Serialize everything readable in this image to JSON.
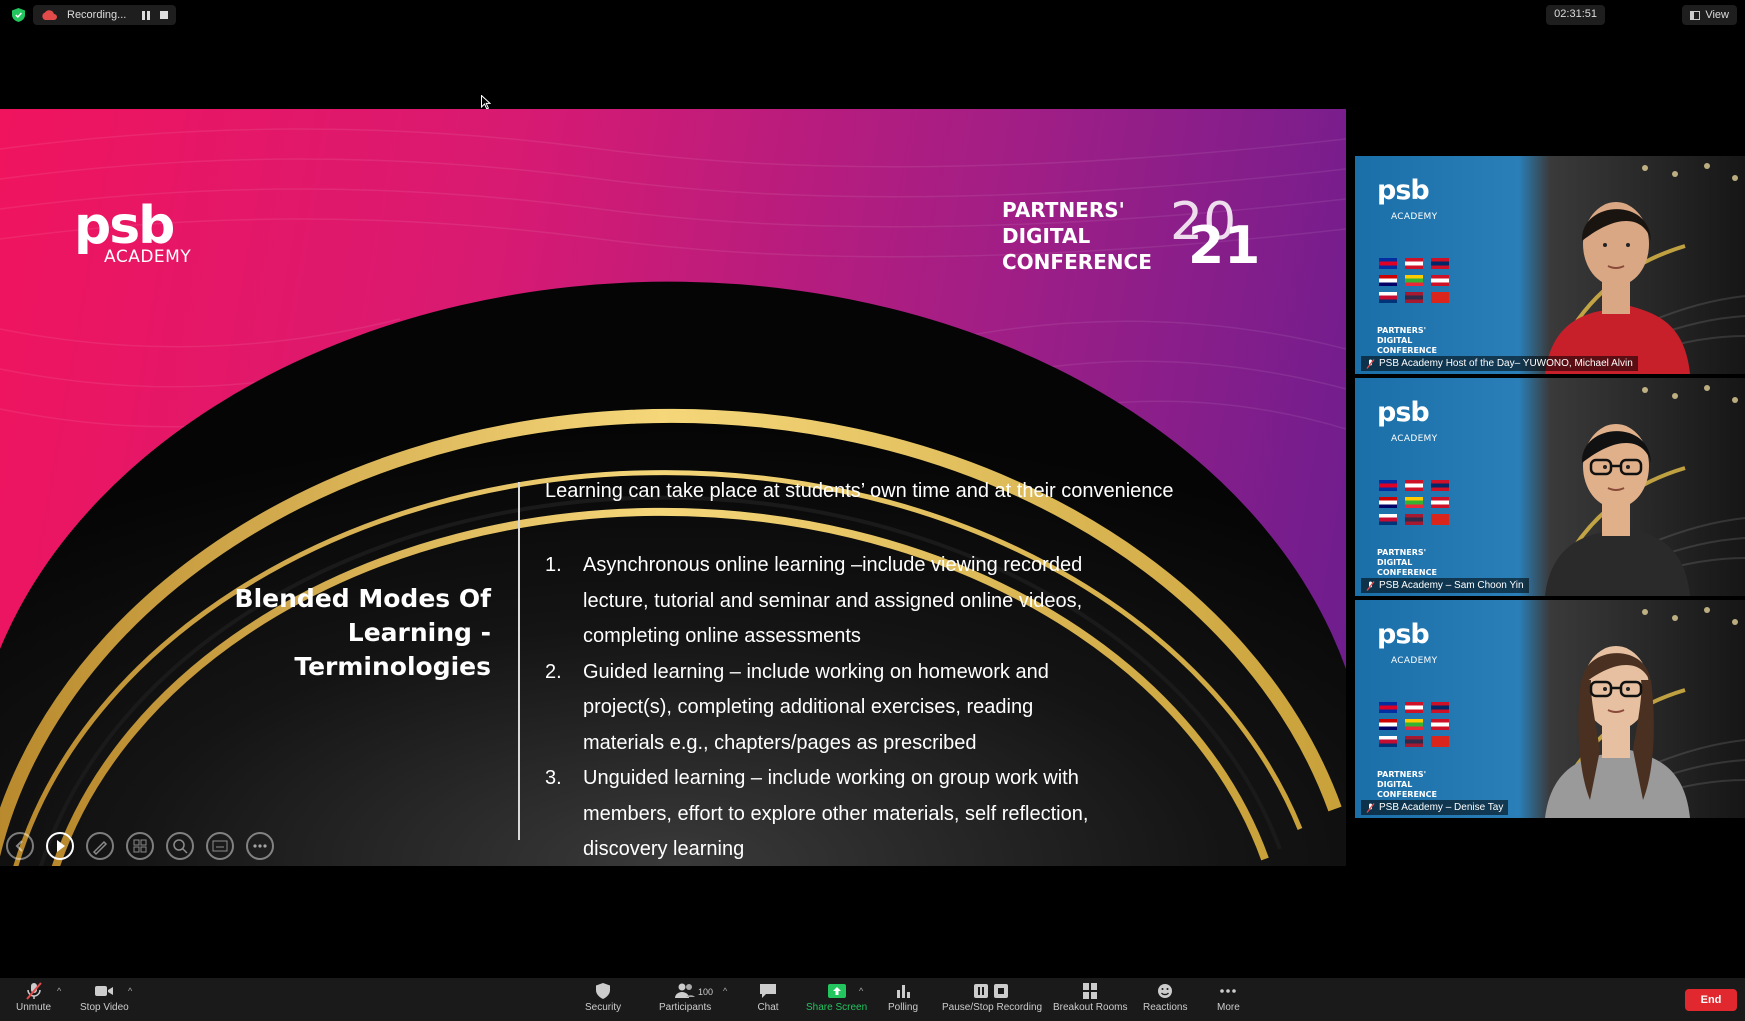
{
  "topbar": {
    "recording_label": "Recording...",
    "clock": "02:31:51",
    "view_label": "View"
  },
  "slide": {
    "logo_main": "psb",
    "logo_sub": "ACADEMY",
    "conference_lines": [
      "PARTNERS'",
      "DIGITAL",
      "CONFERENCE"
    ],
    "conference_year_top": "20",
    "conference_year_bottom": "21",
    "title_lines": [
      "Blended Modes Of",
      "Learning -",
      "Terminologies"
    ],
    "intro": "Learning can take place at students’ own time and at their convenience",
    "items": [
      {
        "num": "1.",
        "text": "Asynchronous online learning –include viewing recorded lecture, tutorial and seminar and assigned online videos, completing online assessments"
      },
      {
        "num": "2.",
        "text": "Guided learning – include working on homework and project(s), completing additional exercises, reading materials e.g., chapters/pages as prescribed"
      },
      {
        "num": "3.",
        "text": "Unguided learning – include working on group work with members, effort to explore other materials, self reflection, discovery learning"
      }
    ]
  },
  "tiles": [
    {
      "name": "PSB Academy  Host of the Day– YUWONO, Michael Alvin",
      "active": false,
      "shirt": "#c8202a",
      "skin": "#d9a783",
      "hair": "#1a1410"
    },
    {
      "name": "PSB Academy – Sam Choon Yin",
      "active": true,
      "shirt": "#2a2a2a",
      "skin": "#e0b08a",
      "hair": "#111"
    },
    {
      "name": "PSB Academy – Denise Tay",
      "active": false,
      "shirt": "#9a9a9a",
      "skin": "#e6c0a0",
      "hair": "#4a3020"
    }
  ],
  "tile_brand": {
    "psb": "psb",
    "sub": "ACADEMY",
    "conf": [
      "PARTNERS'",
      "DIGITAL",
      "CONFERENCE"
    ]
  },
  "toolbar": {
    "unmute": "Unmute",
    "stop_video": "Stop Video",
    "security": "Security",
    "participants": "Participants",
    "participants_count": "100",
    "chat": "Chat",
    "share_screen": "Share Screen",
    "polling": "Polling",
    "pause_stop_recording": "Pause/Stop Recording",
    "breakout_rooms": "Breakout Rooms",
    "reactions": "Reactions",
    "more": "More",
    "end": "End"
  },
  "colors": {
    "slide_pink": "#f0145e",
    "slide_purple": "#6a1d8f",
    "gold": "#e6c14a",
    "share_green": "#22c55e",
    "end_red": "#e0282e",
    "active_speaker": "#e6d44a"
  }
}
